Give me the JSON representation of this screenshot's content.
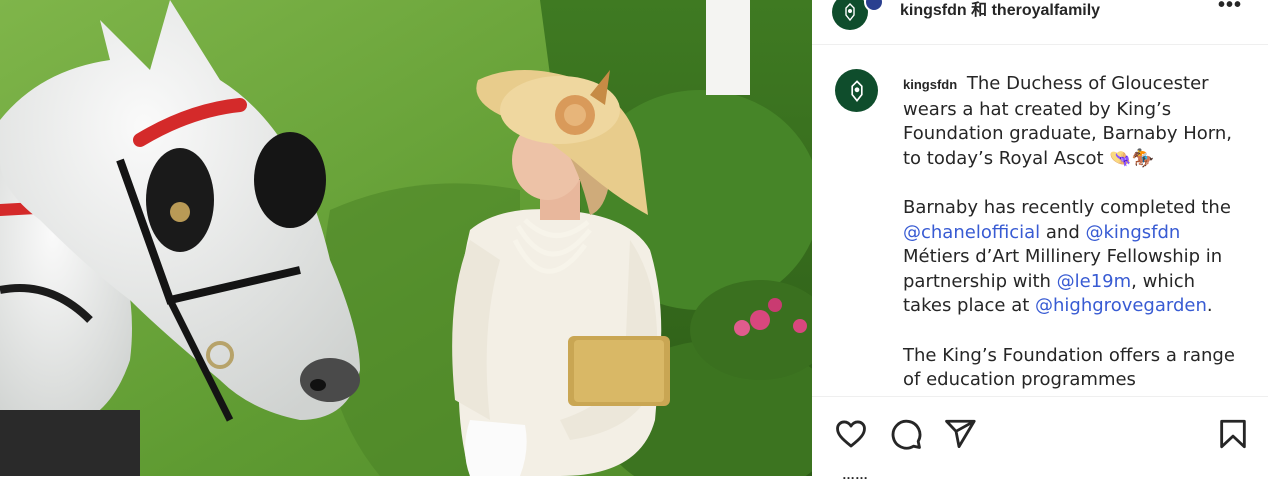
{
  "header": {
    "account_primary": "kingsfdn",
    "conjunction": "和",
    "account_secondary": "theroyalfamily",
    "more_label": "•••"
  },
  "caption": {
    "username": "kingsfdn",
    "paragraph1": "The Duchess of Gloucester wears a hat created by King’s Foundation graduate, Barnaby Horn, to today’s Royal Ascot 👒🏇",
    "p2_start": "Barnaby has recently completed the ",
    "mention_chanel": "@chanelofficial",
    "p2_and": " and ",
    "mention_kingsfdn": "@kingsfdn",
    "p2_mid": " Métiers d’Art Millinery Fellowship in partnership with ",
    "mention_le19m": "@le19m",
    "p2_which": ", which takes place at ",
    "mention_highgrove": "@highgrovegarden",
    "p2_end": ".",
    "paragraph3": "The King’s Foundation offers a range of education programmes"
  },
  "actions": {
    "like_icon": "heart-icon",
    "comment_icon": "comment-icon",
    "share_icon": "paper-plane-icon",
    "save_icon": "bookmark-icon",
    "likes_partial": "……"
  },
  "colors": {
    "mention": "#385bd3",
    "text": "#262626",
    "avatar_bg": "#0f4d2c"
  }
}
